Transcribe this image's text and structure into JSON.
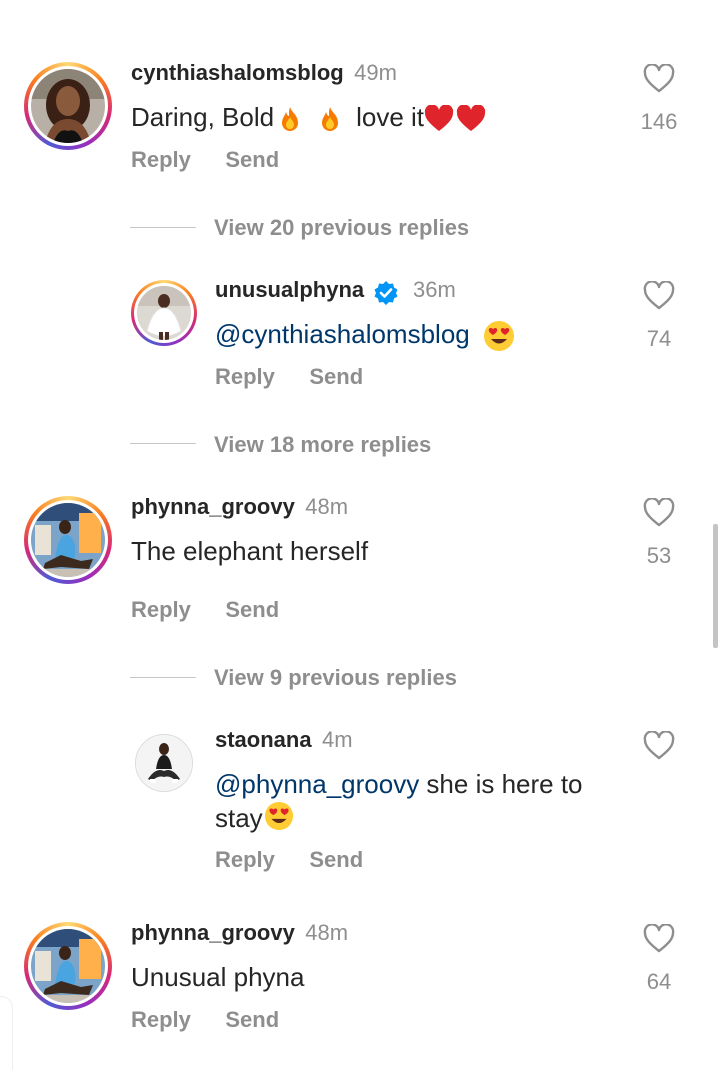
{
  "comments": [
    {
      "username": "cynthiashalomsblog",
      "time": "49m",
      "text_prefix": "Daring, Bold",
      "text_suffix": "love it",
      "likes": "146",
      "reply_label": "Reply",
      "send_label": "Send",
      "view_replies": "View 20 previous replies",
      "reply": {
        "username": "unusualphyna",
        "time": "36m",
        "mention": "@cynthiashalomsblog",
        "likes": "74",
        "reply_label": "Reply",
        "send_label": "Send"
      },
      "view_more": "View 18 more replies"
    },
    {
      "username": "phynna_groovy",
      "time": "48m",
      "text": "The elephant herself",
      "likes": "53",
      "reply_label": "Reply",
      "send_label": "Send",
      "view_replies": "View 9 previous replies",
      "reply": {
        "username": "staonana",
        "time": "4m",
        "mention": "@phynna_groovy",
        "text_line1": " she is here to",
        "text_line2": "stay",
        "reply_label": "Reply",
        "send_label": "Send"
      }
    },
    {
      "username": "phynna_groovy",
      "time": "48m",
      "text": "Unusual phyna",
      "likes": "64",
      "reply_label": "Reply",
      "send_label": "Send"
    }
  ],
  "colors": {
    "text": "#262626",
    "muted": "#8e8e8e",
    "mention": "#00376b",
    "verified": "#0095f6",
    "heart_red": "#e0242c"
  }
}
